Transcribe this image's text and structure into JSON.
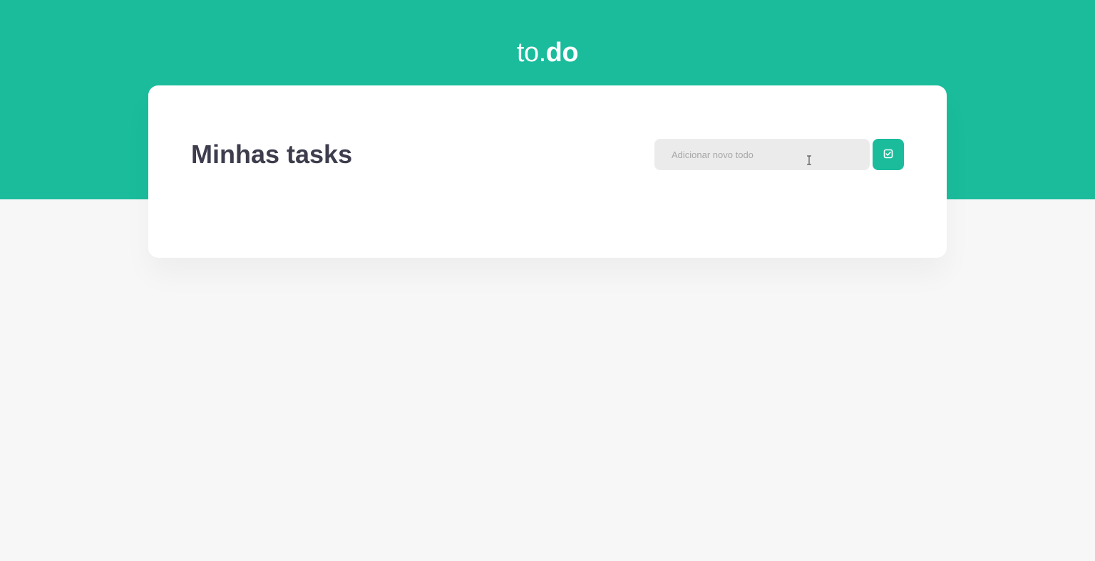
{
  "header": {
    "logo_prefix": "to.",
    "logo_suffix": "do"
  },
  "main": {
    "title": "Minhas tasks",
    "new_todo": {
      "placeholder": "Adicionar novo todo",
      "value": "",
      "submit_icon": "checkbox-check-icon"
    }
  },
  "colors": {
    "brand": "#1abc9c",
    "title_text": "#3d3d4d",
    "input_bg": "#ebebeb",
    "page_bg": "#f7f7f7",
    "card_bg": "#ffffff"
  }
}
